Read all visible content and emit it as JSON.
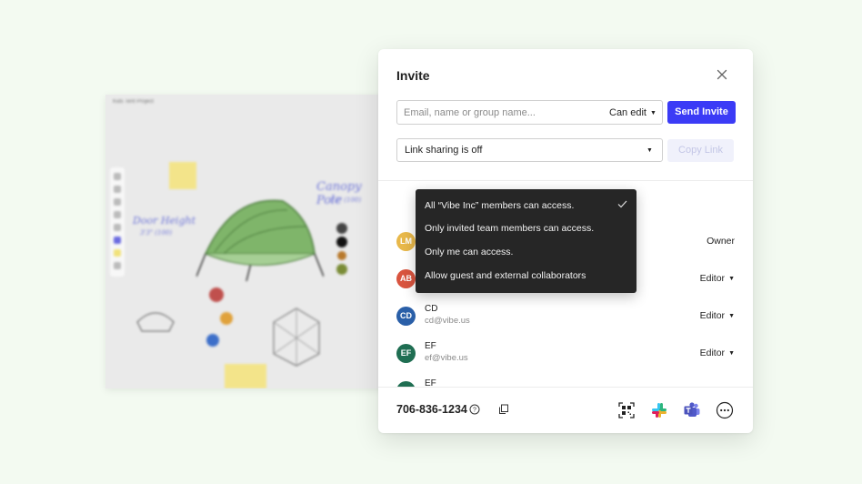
{
  "canvas": {
    "title": "Kids Tent Project",
    "annotations": [
      "Door Height",
      "3'3\" (100)",
      "Canopy Pole",
      "3'3\" (100)"
    ]
  },
  "modal": {
    "title": "Invite",
    "invite_placeholder": "Email, name or group name...",
    "permission": "Can edit",
    "send_label": "Send Invite",
    "link_sharing": "Link sharing is off",
    "copy_link_label": "Copy Link",
    "members": [
      {
        "initials": "LM",
        "name": "",
        "email": "",
        "role": "Owner",
        "color": "#e8b84a"
      },
      {
        "initials": "AB",
        "name": "",
        "email": "",
        "role": "Editor",
        "color": "#d9543f"
      },
      {
        "initials": "CD",
        "name": "CD",
        "email": "cd@vibe.us",
        "role": "Editor",
        "color": "#2a5fa8"
      },
      {
        "initials": "EF",
        "name": "EF",
        "email": "ef@vibe.us",
        "role": "Editor",
        "color": "#1f6e52"
      },
      {
        "initials": "EF",
        "name": "EF",
        "email": "",
        "role": "",
        "color": "#1f6e52"
      }
    ],
    "phone": "706-836-1234",
    "footer_icons": [
      "qr-code-icon",
      "slack-icon",
      "teams-icon",
      "more-icon"
    ]
  },
  "access_menu": {
    "items": [
      "All “Vibe Inc” members can access.",
      "Only invited team members can access.",
      "Only me can access.",
      "Allow guest and external collaborators"
    ],
    "selected_index": 0
  },
  "colors": {
    "background": "#f3faf1",
    "accent": "#3b3bf6",
    "menu_bg": "#262626"
  }
}
